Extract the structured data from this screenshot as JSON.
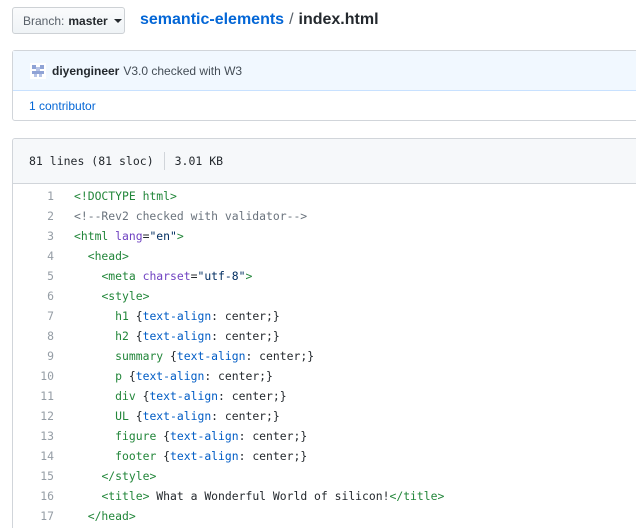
{
  "branch": {
    "prefix": "Branch:",
    "name": "master"
  },
  "breadcrumb": {
    "repo": "semantic-elements",
    "separator": "/",
    "file": "index.html"
  },
  "commit": {
    "author": "diyengineer",
    "message": "V3.0 checked with W3",
    "contributors": "1 contributor"
  },
  "file_info": {
    "lines": "81 lines (81 sloc)",
    "size": "3.01 KB"
  },
  "code_lines": [
    {
      "num": "1",
      "text": "<!DOCTYPE html>"
    },
    {
      "num": "2",
      "text": "<!--Rev2 checked with validator-->"
    },
    {
      "num": "3",
      "text": "<html lang=\"en\">"
    },
    {
      "num": "4",
      "text": "  <head>"
    },
    {
      "num": "5",
      "text": "    <meta charset=\"utf-8\">"
    },
    {
      "num": "6",
      "text": "    <style>"
    },
    {
      "num": "7",
      "text": "      h1 {text-align: center;}"
    },
    {
      "num": "8",
      "text": "      h2 {text-align: center;}"
    },
    {
      "num": "9",
      "text": "      summary {text-align: center;}"
    },
    {
      "num": "10",
      "text": "      p {text-align: center;}"
    },
    {
      "num": "11",
      "text": "      div {text-align: center;}"
    },
    {
      "num": "12",
      "text": "      UL {text-align: center;}"
    },
    {
      "num": "13",
      "text": "      figure {text-align: center;}"
    },
    {
      "num": "14",
      "text": "      footer {text-align: center;}"
    },
    {
      "num": "15",
      "text": "    </style>"
    },
    {
      "num": "16",
      "text": "    <title> What a Wonderful World of silicon!</title>"
    },
    {
      "num": "17",
      "text": "  </head>"
    }
  ],
  "colors": {
    "link": "#0366d6",
    "tag": "#22863a",
    "attribute": "#6f42c1",
    "string": "#032f62",
    "comment": "#6a737d",
    "property": "#005cc5"
  },
  "icons": {
    "avatar": "identicon-avatar",
    "caret": "caret-down-icon"
  }
}
